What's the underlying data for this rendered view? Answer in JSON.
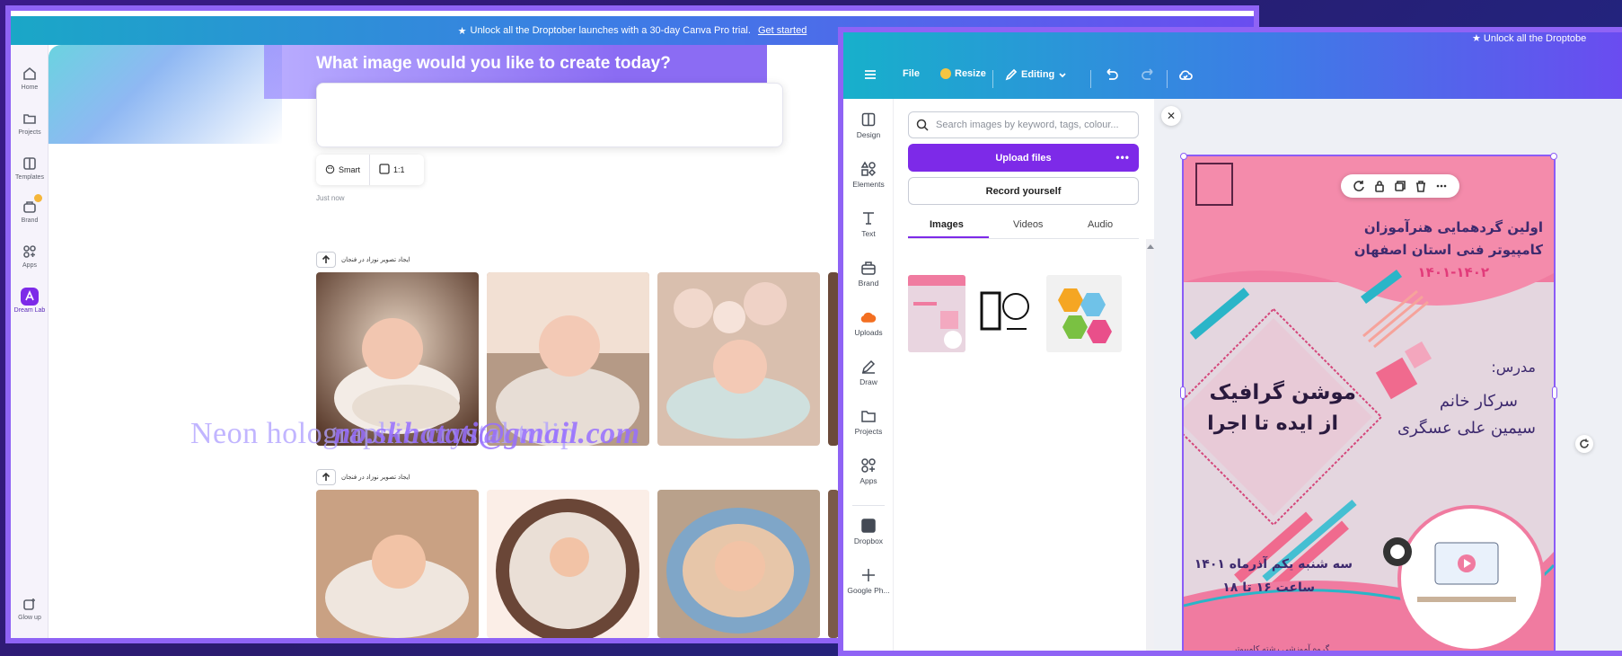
{
  "left": {
    "promo": {
      "text": "Unlock all the Droptober launches with a 30-day Canva Pro trial.",
      "link": "Get started"
    },
    "nav": [
      {
        "label": "Home",
        "icon": "home-icon"
      },
      {
        "label": "Projects",
        "icon": "folder-icon"
      },
      {
        "label": "Templates",
        "icon": "templates-icon"
      },
      {
        "label": "Brand",
        "icon": "brand-icon"
      },
      {
        "label": "Apps",
        "icon": "apps-icon"
      },
      {
        "label": "Dream Lab",
        "icon": "dream-lab-icon"
      },
      {
        "label": "Glow up",
        "icon": "glow-up-icon"
      }
    ],
    "create_title": "What image would you like to create today?",
    "options": {
      "style": "Smart",
      "ratio": "1:1"
    },
    "timestamp": "Just now",
    "prompt_label": "ایجاد تصویر نوزاد در فنجان",
    "watermark": {
      "text": "Neon holographic crystal tulip",
      "email": "no.skhatati@gmail.com"
    }
  },
  "right": {
    "promo": "Unlock all the Droptobe",
    "topbar": {
      "file": "File",
      "resize": "Resize",
      "editing": "Editing"
    },
    "rail": [
      "Design",
      "Elements",
      "Text",
      "Brand",
      "Uploads",
      "Draw",
      "Projects",
      "Apps",
      "Dropbox",
      "Google Ph..."
    ],
    "search_placeholder": "Search images by keyword, tags, colour...",
    "upload_label": "Upload files",
    "record_label": "Record yourself",
    "tabs": [
      "Images",
      "Videos",
      "Audio"
    ],
    "design": {
      "header_lines": [
        "اولین گردهمایی هنرآموزان",
        "کامپیوتر فنی استان اصفهان",
        "۱۴۰۱-۱۴۰۲"
      ],
      "main_title": "موشن گرافیک",
      "subtitle": "از ایده تا اجرا",
      "teacher_label": "مدرس:",
      "teacher_prefix": "سرکار خانم",
      "teacher_name": "سیمین علی عسگری",
      "date_line": "سه شنبه یکم آذرماه ۱۴۰۱",
      "time_line": "ساعت ۱۶ تا ۱۸",
      "footer": "گروه آموزشی رشته کامپیوتر"
    }
  },
  "colors": {
    "accent_purple": "#7d2ae8",
    "frame": "#8f63f5",
    "design_pink": "#f07ba0",
    "design_bg": "#e3d5e0"
  }
}
